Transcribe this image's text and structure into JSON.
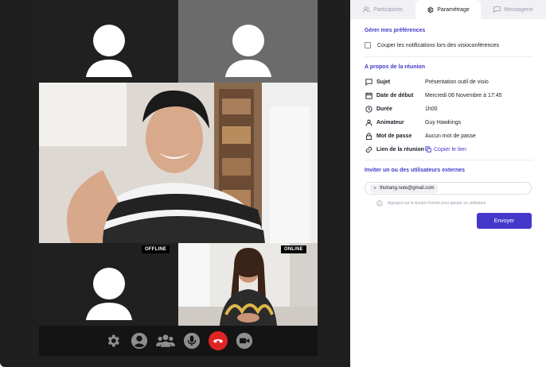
{
  "tabs": [
    {
      "label": "Participants",
      "icon": "users-icon",
      "active": false
    },
    {
      "label": "Paramétrage",
      "icon": "gear-icon",
      "active": true
    },
    {
      "label": "Messagerie",
      "icon": "chat-icon",
      "active": false
    }
  ],
  "preferences": {
    "title": "Gérer mes préférences",
    "mute_label": "Couper les notifications lors des visioconférences",
    "mute_checked": false
  },
  "about": {
    "title": "A propos de la réunion",
    "rows": [
      {
        "label": "Sujet",
        "value": "Présentation outil de visio",
        "icon": "chat-bubble-icon"
      },
      {
        "label": "Date de début",
        "value": "Mercredi 06 Novembre à 17:45",
        "icon": "calendar-icon"
      },
      {
        "label": "Durée",
        "value": "1h00",
        "icon": "clock-icon"
      },
      {
        "label": "Animateur",
        "value": "Guy Hawkings",
        "icon": "user-icon"
      },
      {
        "label": "Mot de passe",
        "value": "Aucun mot de passe",
        "icon": "lock-icon"
      },
      {
        "label": "Lien de la réunion",
        "value": "Copier le lien",
        "icon": "link-icon"
      }
    ]
  },
  "invite": {
    "title": "Inviter un ou des utilisateurs externes",
    "email_chip": "thuhang.nute@gmail.com",
    "hint": "Appuyez sur le bouton Entrée pour ajouter un utilisateur",
    "send_label": "Envoyer"
  },
  "video": {
    "badges": {
      "offline": "OFFLINE",
      "online": "ONLINE"
    },
    "controls": [
      "gear-icon",
      "profile-icon",
      "participants-icon",
      "microphone-icon",
      "hang-up-icon",
      "camera-icon"
    ]
  },
  "colors": {
    "accent": "#4338ca",
    "hangup": "#e02424",
    "video_bg": "#1f1f1f"
  }
}
